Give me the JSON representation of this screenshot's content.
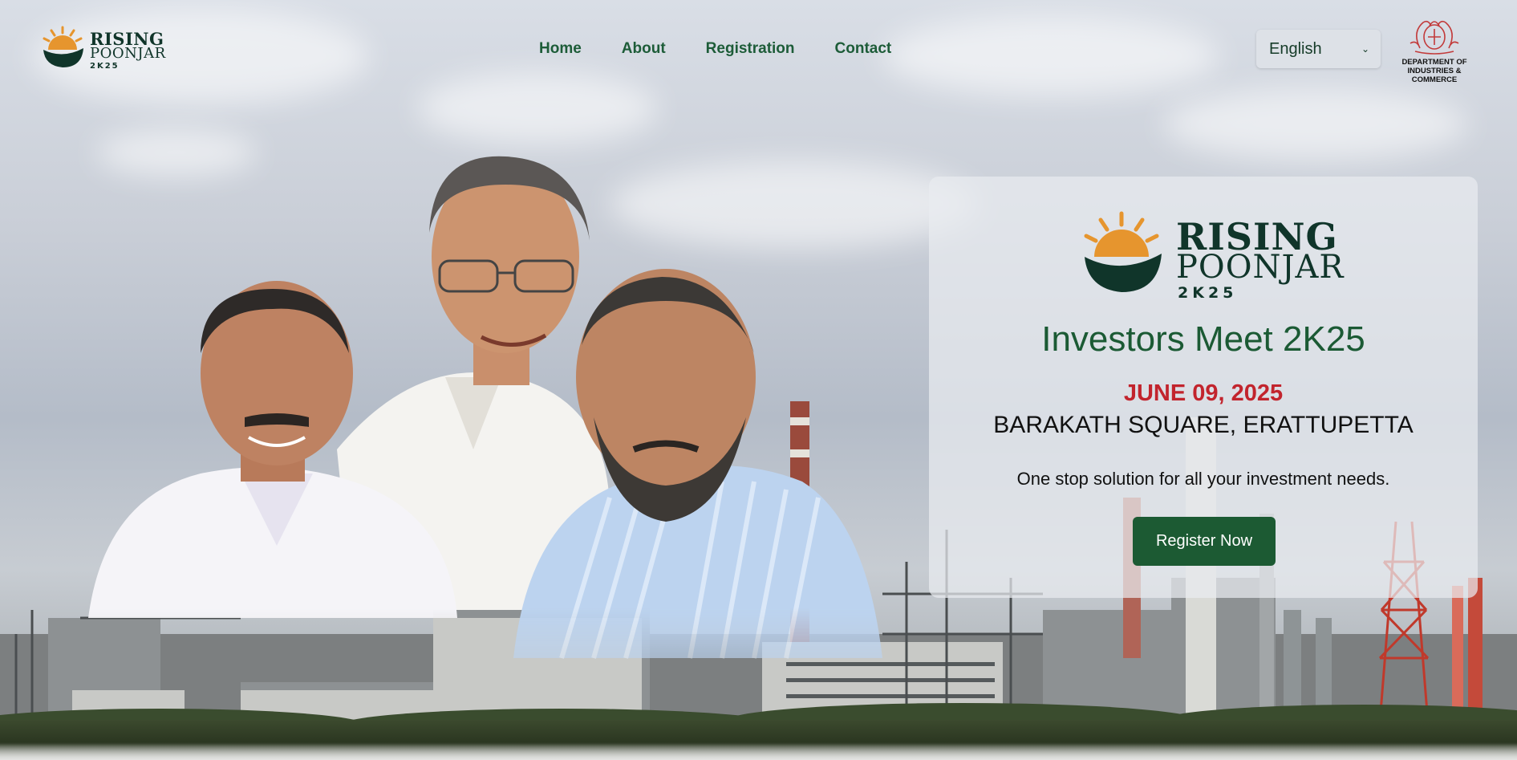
{
  "brand": {
    "name_line1": "RISING",
    "name_line2": "POONJAR",
    "year": "2K25",
    "colors": {
      "dark_green": "#10352a",
      "sun_orange": "#e6952e"
    }
  },
  "nav": {
    "items": [
      {
        "label": "Home"
      },
      {
        "label": "About"
      },
      {
        "label": "Registration"
      },
      {
        "label": "Contact"
      }
    ]
  },
  "language_select": {
    "value": "English",
    "icon": "chevron-down-icon"
  },
  "department": {
    "line1": "DEPARTMENT OF",
    "line2": "INDUSTRIES & COMMERCE",
    "emblem": "kerala-emblem-icon"
  },
  "hero": {
    "event_title": "Investors Meet 2K25",
    "date": "JUNE 09, 2025",
    "venue": "BARAKATH SQUARE, ERATTUPETTA",
    "tagline": "One stop solution for all your investment needs.",
    "cta_label": "Register Now",
    "colors": {
      "title_green": "#1b5a34",
      "date_red": "#c2242d",
      "button_green": "#1c5a33"
    }
  }
}
